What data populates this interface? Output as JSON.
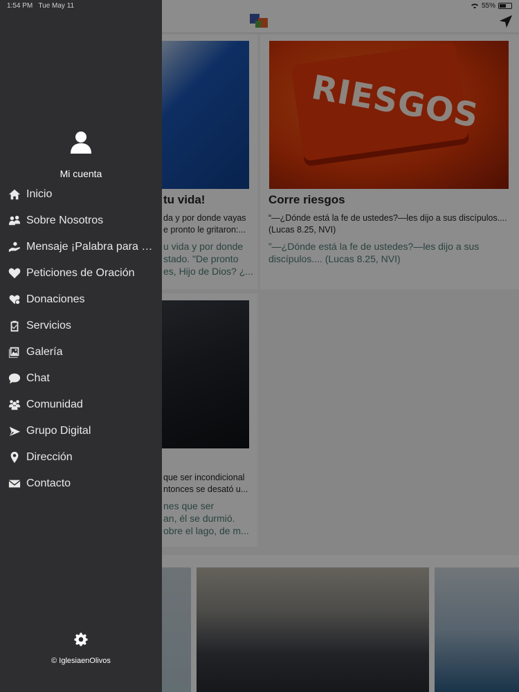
{
  "status_bar": {
    "time": "1:54 PM",
    "date": "Tue May 11",
    "battery": "55%"
  },
  "drawer": {
    "account_label": "Mi cuenta",
    "menu": [
      {
        "label": "Inicio",
        "icon": "home-icon"
      },
      {
        "label": "Sobre Nosotros",
        "icon": "people-icon"
      },
      {
        "label": "Mensaje ¡Palabra para tu...",
        "icon": "hand-give-icon"
      },
      {
        "label": "Peticiones de Oración",
        "icon": "heart-icon"
      },
      {
        "label": "Donaciones",
        "icon": "heart-hand-icon"
      },
      {
        "label": "Servicios",
        "icon": "clipboard-icon"
      },
      {
        "label": "Galería",
        "icon": "gallery-icon"
      },
      {
        "label": "Chat",
        "icon": "chat-bubble-icon"
      },
      {
        "label": "Comunidad",
        "icon": "community-icon"
      },
      {
        "label": "Grupo Digital",
        "icon": "paper-plane-icon"
      },
      {
        "label": "Dirección",
        "icon": "map-pin-icon"
      },
      {
        "label": "Contacto",
        "icon": "envelope-icon"
      }
    ],
    "footer": {
      "copyright": "© IglesiaenOlivos"
    }
  },
  "cards": {
    "card1": {
      "title": "tu vida!",
      "desc": "da y por donde vayas\ne pronto le gritaron:...",
      "quote": "u vida y por donde\nstado. \"De pronto\nes, Hijo de Dios? ¿..."
    },
    "card2": {
      "image_text": "RIESGOS",
      "title": "Corre riesgos",
      "desc": "“—¿Dónde está la fe de ustedes?—les dijo a sus discípulos.... (Lucas 8.25, NVI)",
      "quote": "”—¿Dónde está la fe de ustedes?—les dijo a sus discípulos.... (Lucas 8.25, NVI)"
    },
    "card3": {
      "desc": "que ser incondicional\nntonces se desató u...",
      "quote": "nes que ser\nan, él se durmió.\nobre el lago, de m..."
    }
  }
}
